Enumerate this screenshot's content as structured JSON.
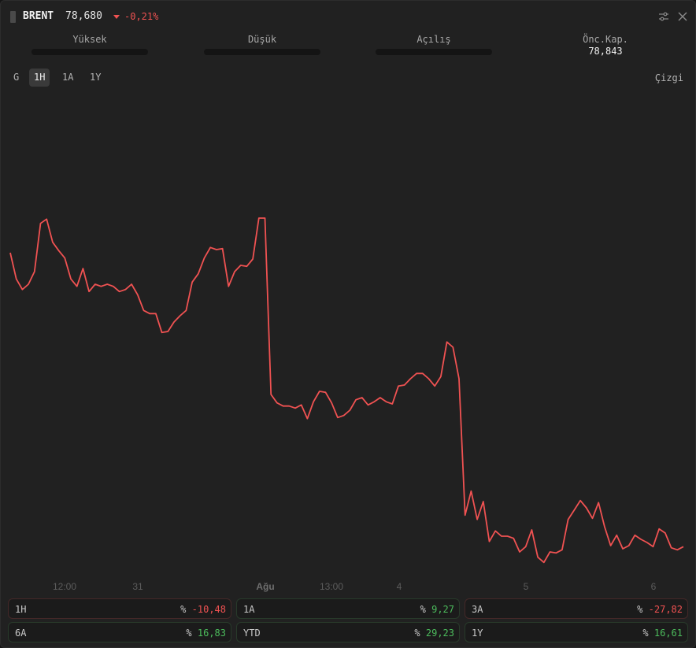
{
  "header": {
    "symbol": "BRENT",
    "price": "78,680",
    "change": "-0,21%",
    "change_color": "#f05252",
    "icons": [
      "drag-handle",
      "sliders-icon",
      "close-icon"
    ]
  },
  "stats": [
    {
      "label": "Yüksek",
      "value": ""
    },
    {
      "label": "Düşük",
      "value": ""
    },
    {
      "label": "Açılış",
      "value": ""
    },
    {
      "label": "Önc.Kap.",
      "value": "78,843"
    }
  ],
  "range_tabs": [
    {
      "label": "G",
      "active": false
    },
    {
      "label": "1H",
      "active": true
    },
    {
      "label": "1A",
      "active": false
    },
    {
      "label": "1Y",
      "active": false
    }
  ],
  "chart_type_label": "Çizgi",
  "chart_data": {
    "type": "line",
    "line_color": "#f05252",
    "grid": false,
    "x_tick_labels": [
      "12:00",
      "31",
      "Ağu",
      "13:00",
      "4",
      "5",
      "6"
    ],
    "values": [
      81.3,
      81.05,
      80.95,
      81.0,
      81.12,
      81.58,
      81.62,
      81.4,
      81.32,
      81.25,
      81.05,
      80.98,
      81.15,
      80.93,
      81.0,
      80.98,
      81.0,
      80.98,
      80.93,
      80.95,
      81.0,
      80.9,
      80.75,
      80.72,
      80.72,
      80.54,
      80.55,
      80.64,
      80.7,
      80.75,
      81.02,
      81.1,
      81.25,
      81.35,
      81.33,
      81.34,
      80.98,
      81.12,
      81.18,
      81.17,
      81.24,
      81.63,
      81.63,
      79.95,
      79.87,
      79.84,
      79.84,
      79.82,
      79.85,
      79.72,
      79.88,
      79.98,
      79.97,
      79.87,
      79.73,
      79.75,
      79.8,
      79.9,
      79.92,
      79.85,
      79.88,
      79.92,
      79.88,
      79.86,
      80.03,
      80.04,
      80.1,
      80.15,
      80.15,
      80.1,
      80.03,
      80.12,
      80.45,
      80.4,
      80.1,
      78.8,
      79.03,
      78.76,
      78.93,
      78.55,
      78.65,
      78.6,
      78.6,
      78.58,
      78.45,
      78.5,
      78.66,
      78.4,
      78.35,
      78.45,
      78.44,
      78.47,
      78.76,
      78.85,
      78.94,
      78.87,
      78.77,
      78.92,
      78.69,
      78.51,
      78.61,
      78.48,
      78.51,
      78.61,
      78.57,
      78.54,
      78.5,
      78.67,
      78.63,
      78.49,
      78.47,
      78.5
    ],
    "ylim": [
      78.0,
      82.8
    ]
  },
  "performance": [
    {
      "label": "1H",
      "prefix": "%",
      "value": "-10,48",
      "sign": "neg"
    },
    {
      "label": "1A",
      "prefix": "%",
      "value": "9,27",
      "sign": "pos"
    },
    {
      "label": "3A",
      "prefix": "%",
      "value": "-27,82",
      "sign": "neg"
    },
    {
      "label": "6A",
      "prefix": "%",
      "value": "16,83",
      "sign": "pos"
    },
    {
      "label": "YTD",
      "prefix": "%",
      "value": "29,23",
      "sign": "pos"
    },
    {
      "label": "1Y",
      "prefix": "%",
      "value": "16,61",
      "sign": "pos"
    }
  ]
}
